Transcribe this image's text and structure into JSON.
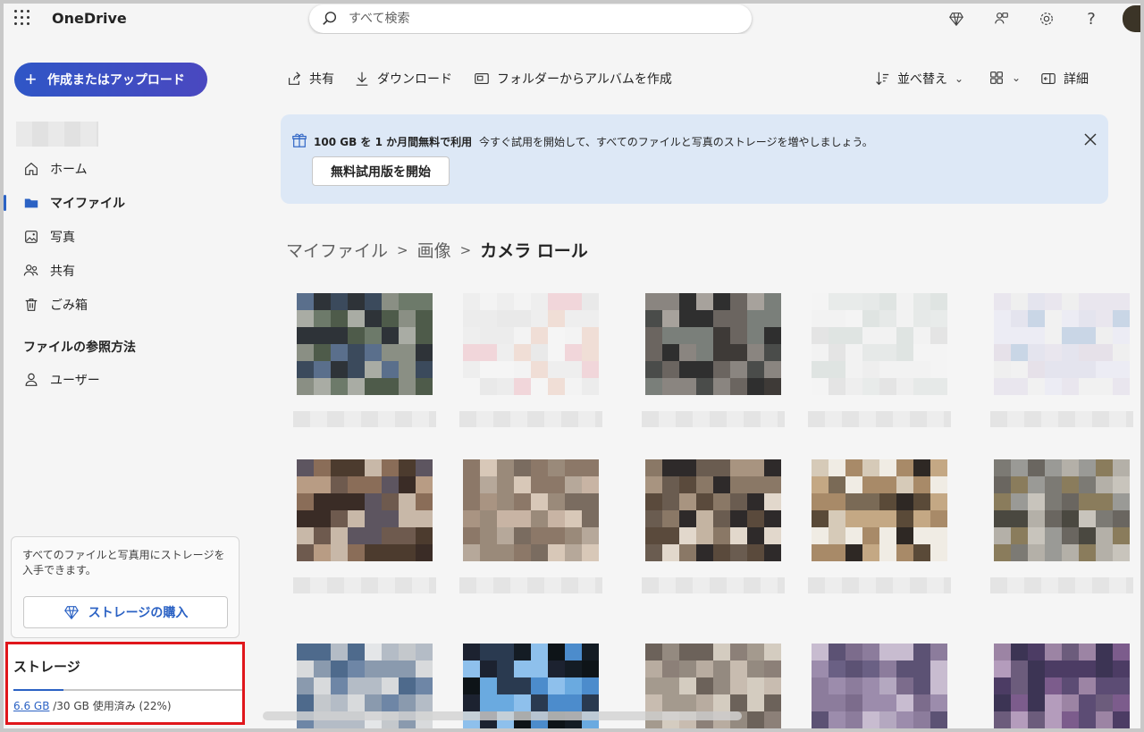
{
  "app": {
    "title": "OneDrive"
  },
  "search": {
    "placeholder": "すべて検索"
  },
  "header_icons": [
    "diamond-icon",
    "people-icon",
    "gear-icon",
    "help-icon"
  ],
  "sidebar": {
    "create_label": "作成またはアップロード",
    "nav": [
      {
        "label": "ホーム",
        "icon": "home-icon"
      },
      {
        "label": "マイファイル",
        "icon": "folder-icon",
        "active": true
      },
      {
        "label": "写真",
        "icon": "photo-icon"
      },
      {
        "label": "共有",
        "icon": "people-icon"
      },
      {
        "label": "ごみ箱",
        "icon": "trash-icon"
      }
    ],
    "browse_title": "ファイルの参照方法",
    "browse_items": [
      {
        "label": "ユーザー",
        "icon": "person-icon"
      }
    ],
    "promo_text": "すべてのファイルと写真用にストレージを入手できます。",
    "buy_label": "ストレージの購入",
    "storage": {
      "title": "ストレージ",
      "used": "6.6 GB",
      "rest": " /30 GB 使用済み (22%)",
      "fraction": 0.22
    }
  },
  "toolbar": {
    "share": "共有",
    "download": "ダウンロード",
    "album": "フォルダーからアルバムを作成",
    "sort": "並べ替え",
    "details": "詳細"
  },
  "banner": {
    "headline": "100 GB を 1 か月間無料で利用",
    "sub": "今すぐ試用を開始して、すべてのファイルと写真のストレージを増やしましょう。",
    "trial": "無料試用版を開始"
  },
  "breadcrumb": {
    "items": [
      "マイファイル",
      "画像"
    ],
    "current": "カメラ ロール"
  },
  "colors": {
    "accent": "#2b62c4",
    "highlight": "#e0161b",
    "banner_bg": "#dde8f6"
  }
}
